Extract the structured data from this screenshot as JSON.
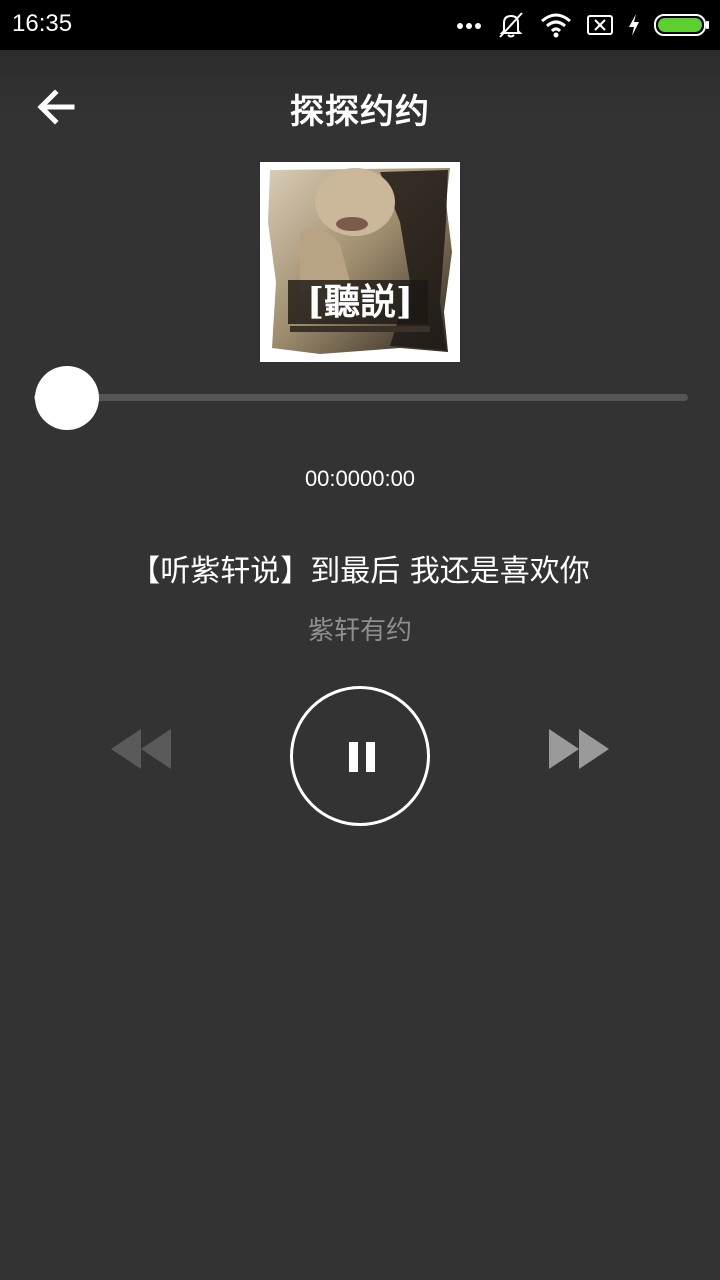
{
  "status_bar": {
    "time": "16:35",
    "icons": [
      "more-dots-icon",
      "muted-vibrate-icon",
      "wifi-icon",
      "sim-off-icon",
      "charging-icon",
      "battery-icon"
    ],
    "battery_color": "#5cd02e"
  },
  "header": {
    "back_icon": "back-arrow-icon",
    "title": "探探约约"
  },
  "cover": {
    "caption": "[聽説]"
  },
  "player": {
    "progress": 0.05,
    "time_display": "00:0000:00",
    "song_title": "【听紫轩说】到最后 我还是喜欢你",
    "artist": "紫轩有约",
    "controls": [
      "rewind-icon",
      "pause-icon",
      "fast-forward-icon"
    ],
    "state": "playing"
  },
  "colors": {
    "background": "#333333",
    "status_bar": "#000000",
    "disabled_control": "#5a5a5a",
    "enabled_control": "#9a9a9a",
    "artist_text": "#8e8e8e"
  }
}
